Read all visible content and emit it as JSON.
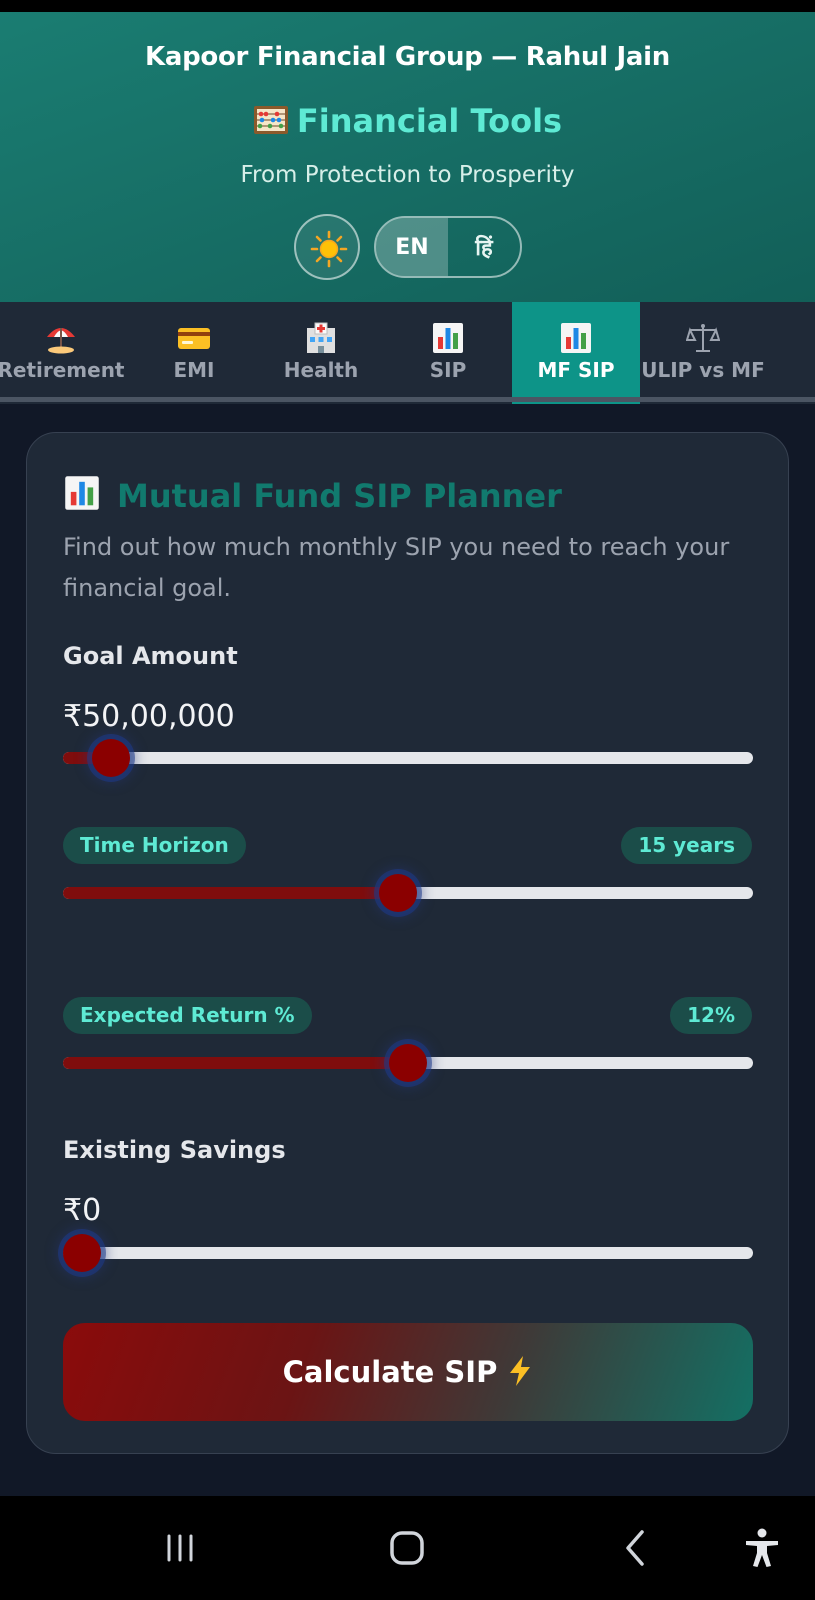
{
  "header": {
    "brand": "Kapoor Financial Group — Rahul Jain",
    "title": "Financial Tools",
    "tagline": "From Protection to Prosperity",
    "lang_options": [
      "EN",
      "हिं"
    ],
    "active_lang": "EN"
  },
  "tabs": [
    {
      "label": "Retirement",
      "icon": "beach-umbrella-icon"
    },
    {
      "label": "EMI",
      "icon": "credit-card-icon"
    },
    {
      "label": "Health",
      "icon": "hospital-icon"
    },
    {
      "label": "SIP",
      "icon": "bar-chart-icon"
    },
    {
      "label": "MF SIP",
      "icon": "bar-chart-icon",
      "active": true
    },
    {
      "label": "ULIP vs MF",
      "icon": "scales-icon"
    },
    {
      "label": "",
      "icon": "partial-tab-icon"
    }
  ],
  "planner": {
    "title": "Mutual Fund SIP Planner",
    "description": "Find out how much monthly SIP you need to reach your financial goal.",
    "goal_label": "Goal Amount",
    "goal_value": "₹50,00,000",
    "goal_level": 0.07,
    "horizon_label": "Time Horizon",
    "horizon_value": "15 years",
    "horizon_level": 0.485,
    "return_label": "Expected Return %",
    "return_value": "12%",
    "return_level": 0.5,
    "savings_label": "Existing Savings",
    "savings_value": "₹0",
    "savings_level": 0.0,
    "calculate_label": "Calculate SIP"
  },
  "colors": {
    "accent": "#5eead4",
    "active_tab": "#0d9488",
    "slider_fill": "#8b0000",
    "card_bg": "#1f2937"
  }
}
